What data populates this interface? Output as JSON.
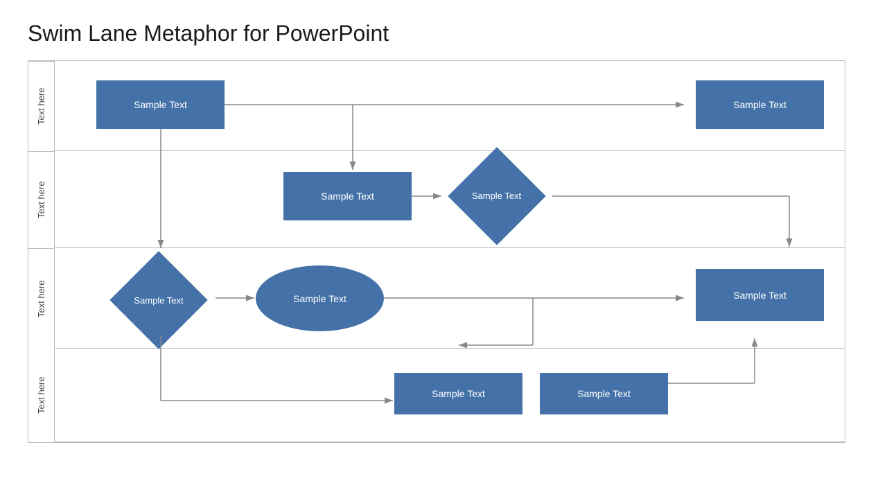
{
  "title": "Swim Lane Metaphor for PowerPoint",
  "lanes": [
    {
      "id": "lane1",
      "label": "Text here"
    },
    {
      "id": "lane2",
      "label": "Text here"
    },
    {
      "id": "lane3",
      "label": "Text here"
    },
    {
      "id": "lane4",
      "label": "Text here"
    }
  ],
  "shapes": {
    "rect1": "Sample Text",
    "rect2": "Sample Text",
    "rect3": "Sample Text",
    "rect4": "Sample Text",
    "rect5": "Sample Text",
    "rect6": "Sample Text",
    "diamond1": "Sample Text",
    "diamond2": "Sample Text",
    "ellipse1": "Sample Text"
  },
  "colors": {
    "blue": "#4472a8",
    "arrow": "#888888"
  }
}
